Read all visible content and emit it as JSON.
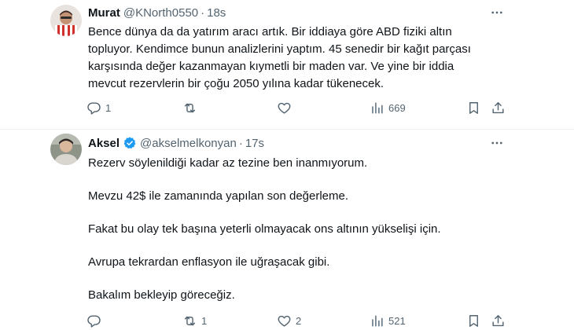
{
  "tweets": [
    {
      "author": "Murat",
      "handle": "@KNorth0550",
      "time": "18s",
      "lines": [
        "Bence dünya da da yatırım aracı artık. Bir iddiaya göre ABD fiziki altın",
        "topluyor. Kendimce bunun analizlerini yaptım. 45 senedir bir kağıt parçası",
        "karşısında değer kazanmayan kıymetli bir maden var. Ve yine bir iddia",
        "mevcut rezervlerin bir çoğu 2050 yılına kadar tükenecek."
      ],
      "stats": {
        "replies": "1",
        "retweets": "",
        "likes": "",
        "views": "669"
      }
    },
    {
      "author": "Aksel",
      "handle": "@akselmelkonyan",
      "time": "17s",
      "verified": true,
      "paragraphs": [
        "Rezerv söylenildiği kadar az tezine ben inanmıyorum.",
        "Mevzu 42$ ile zamanında yapılan son değerleme.",
        "Fakat bu olay tek başına yeterli olmayacak ons altının yükselişi için.",
        "Avrupa tekrardan enflasyon ile uğraşacak gibi.",
        "Bakalım bekleyip göreceğiz."
      ],
      "stats": {
        "replies": "",
        "retweets": "1",
        "likes": "2",
        "views": "521"
      }
    }
  ],
  "icons": {
    "more": "more-horizontal-icon",
    "reply": "reply-icon",
    "retweet": "retweet-icon",
    "like": "heart-icon",
    "views": "views-chart-icon",
    "bookmark": "bookmark-icon",
    "share": "share-icon",
    "verified": "verified-badge-icon"
  },
  "colors": {
    "text": "#0f1419",
    "secondary": "#536471",
    "verified": "#1d9bf0",
    "divider": "#eff3f4"
  }
}
